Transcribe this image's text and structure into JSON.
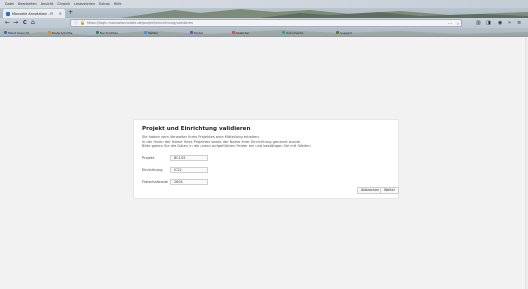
{
  "menubar": [
    "Datei",
    "Bearbeiten",
    "Ansicht",
    "Chronik",
    "Lesezeichen",
    "Extras",
    "Hilfe"
  ],
  "tab": {
    "title": "Manuelle Annotation - Fi",
    "close_icon": "close-icon",
    "new_tab_glyph": "+"
  },
  "nav": {
    "back_glyph": "←",
    "forward_glyph": "→",
    "reload_glyph": "C",
    "home_glyph": "⌂",
    "url": "https://login.manualannotate.de/projekt/einrichtung/validieren",
    "url_menu_glyph": "···",
    "bookmark_star_glyph": "☆"
  },
  "bookmarks": [
    {
      "label": "Meist besucht",
      "color": "#3a6db3"
    },
    {
      "label": "Erste Schritte",
      "color": "#e4852a"
    },
    {
      "label": "Nachrichten",
      "color": "#2e8b57"
    },
    {
      "label": "Wetter",
      "color": "#4a90d9"
    },
    {
      "label": "Portal",
      "color": "#7a4cc2"
    },
    {
      "label": "Kalender",
      "color": "#d94a4a"
    },
    {
      "label": "Dokumente",
      "color": "#2aa0a4"
    },
    {
      "label": "Support",
      "color": "#5b7a2e"
    }
  ],
  "dialog": {
    "title": "Projekt und Einrichtung validieren",
    "intro": [
      "Sie haben vom Verwalter Ihres Projektes eine Mitteilung erhalten,",
      "in der Ihnen der Name Ihres Projektes sowie der Name Ihrer Einrichtung genannt wurde.",
      "Bitte geben Sie die Daten in die unten aufgeführten Felder ein und bestätigen Sie mit 'Weiter'."
    ],
    "fields": [
      {
        "label": "Projekt",
        "value": "BC143"
      },
      {
        "label": "Einrichtung",
        "value": "IC22"
      },
      {
        "label": "Freischaltcode",
        "value": "2604"
      }
    ],
    "back_label": "Abbrechen",
    "next_label": "Weiter"
  }
}
